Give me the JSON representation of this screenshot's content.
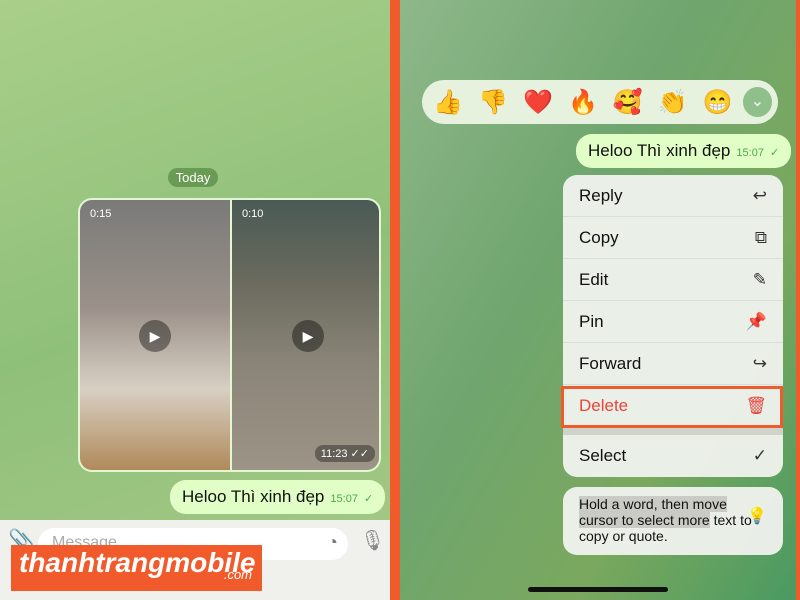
{
  "left": {
    "date_label": "Today",
    "videos": [
      {
        "duration": "0:15"
      },
      {
        "duration": "0:10"
      }
    ],
    "media_time": "11:23",
    "message": {
      "text": "Heloo Thì xinh đẹp",
      "time": "15:07"
    },
    "input_placeholder": "Message"
  },
  "right": {
    "reactions": [
      "👍",
      "👎",
      "❤️",
      "🔥",
      "🥰",
      "👏",
      "😁"
    ],
    "message": {
      "text": "Heloo Thì xinh đẹp",
      "time": "15:07"
    },
    "menu": [
      {
        "label": "Reply",
        "icon": "↩"
      },
      {
        "label": "Copy",
        "icon": "⧉"
      },
      {
        "label": "Edit",
        "icon": "✎"
      },
      {
        "label": "Pin",
        "icon": "📌"
      },
      {
        "label": "Forward",
        "icon": "↪"
      },
      {
        "label": "Delete",
        "icon": "🗑"
      },
      {
        "label": "Select",
        "icon": "✓"
      }
    ],
    "hint": {
      "selected": "Hold a word, then move cursor to select more",
      "rest": " text to copy or quote."
    }
  },
  "watermark": {
    "brand": "thanhtrangmobile",
    "suffix": ".com"
  },
  "colors": {
    "accent": "#f15a2b",
    "bubble": "#e1fec6",
    "delete": "#e8453c"
  }
}
